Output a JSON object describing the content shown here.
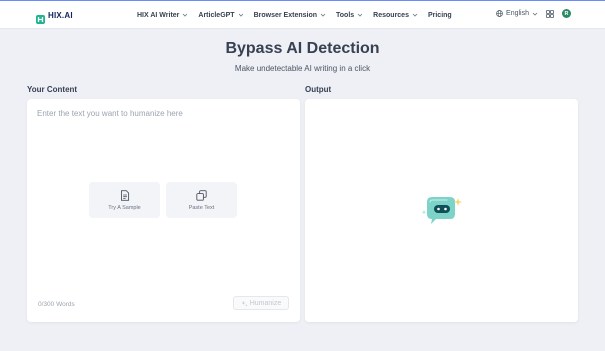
{
  "brand": {
    "name": "HIX.AI"
  },
  "nav": {
    "items": [
      {
        "label": "HIX AI Writer",
        "has_dropdown": true
      },
      {
        "label": "ArticleGPT",
        "has_dropdown": true
      },
      {
        "label": "Browser Extension",
        "has_dropdown": true
      },
      {
        "label": "Tools",
        "has_dropdown": true
      },
      {
        "label": "Resources",
        "has_dropdown": true
      },
      {
        "label": "Pricing",
        "has_dropdown": false
      }
    ]
  },
  "header_right": {
    "language": "English",
    "language_icon": "globe-icon",
    "apps_icon": "grid-icon",
    "avatar_initial": "R",
    "avatar_color": "#2b8a66"
  },
  "page": {
    "title": "Bypass AI Detection",
    "subtitle": "Make undetectable AI writing in a click"
  },
  "input": {
    "section_label": "Your Content",
    "placeholder": "Enter the text you want to humanize here",
    "value": "",
    "try_sample_label": "Try A Sample",
    "paste_text_label": "Paste Text",
    "word_count": "0/300 Words",
    "humanize_label": "Humanize"
  },
  "output": {
    "section_label": "Output",
    "mascot_icon": "chat-bot-icon"
  },
  "colors": {
    "background": "#eef0f6",
    "accent": "#6b8cff",
    "mascot": "#7dd3c8"
  }
}
